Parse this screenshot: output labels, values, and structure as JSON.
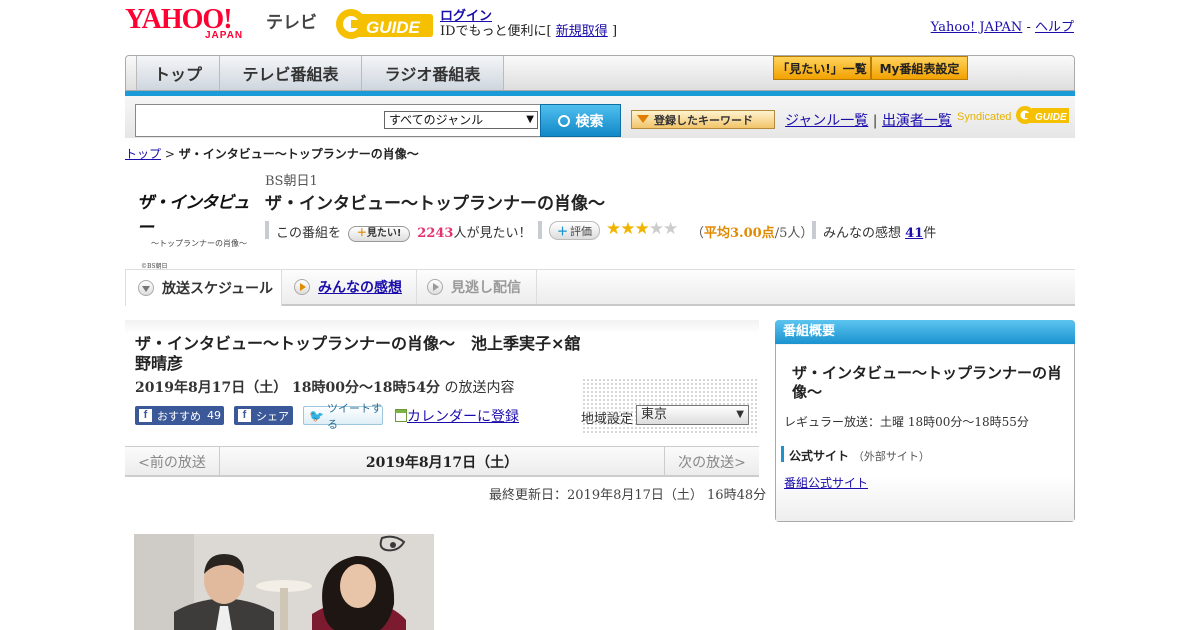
{
  "header": {
    "logo_text": "YAHOO!",
    "logo_sub": "JAPAN",
    "service_name": "テレビ",
    "gguide_text": "GUIDE",
    "login": "ログイン",
    "id_text": "IDでもっと便利に[",
    "signup": "新規取得",
    "id_close": "]",
    "yahoo_japan": "Yahoo! JAPAN",
    "sep": "-",
    "help": "ヘルプ"
  },
  "nav": {
    "tabs": [
      "トップ",
      "テレビ番組表",
      "ラジオ番組表"
    ],
    "want_list": "「見たい!」一覧",
    "my_schedule": "My番組表設定"
  },
  "search": {
    "genre_selected": "すべてのジャンル",
    "button": "検索",
    "keyword_button": "登録したキーワード",
    "genre_list": "ジャンル一覧",
    "divider": "|",
    "cast_list": "出演者一覧",
    "syndicated": "Syndicated"
  },
  "breadcrumb": {
    "top": "トップ",
    "sep": " > ",
    "current": "ザ・インタビュー～トップランナーの肖像～"
  },
  "program": {
    "logo_text": "ザ・インタビュー",
    "logo_sub": "～トップランナーの肖像～",
    "logo_copy": "©BS朝日",
    "channel": "BS朝日1",
    "title": "ザ・インタビュー～トップランナーの肖像～",
    "want_prefix": "この番組を",
    "want_button": "見たい!",
    "want_count": "2243",
    "want_suffix": "人が見たい！",
    "rating_button": "評価",
    "rating_value": 3,
    "rating_max": 5,
    "avg_open": "（",
    "avg_label": "平均3.00点",
    "avg_count": "/5人）",
    "review_label": "みんなの感想",
    "review_count": "41",
    "review_unit": "件"
  },
  "subtabs": {
    "schedule": "放送スケジュール",
    "reviews": "みんなの感想",
    "vod": "見逃し配信"
  },
  "episode": {
    "title": "ザ・インタビュー～トップランナーの肖像～　池上季実子×舘野晴彦",
    "date": "2019年8月17日（土）  18時00分～18時54分",
    "date_suffix": "の放送内容",
    "fb_recommend": "おすすめ",
    "fb_count": "49",
    "fb_share": "シェア",
    "tweet": "ツイートする",
    "calendar": "カレンダーに登録",
    "region_label": "地域設定",
    "region_value": "東京"
  },
  "pager": {
    "prev": "<前の放送",
    "date": "2019年8月17日（土）",
    "next": "次の放送>"
  },
  "updated": "最終更新日：2019年8月17日（土）  16時48分",
  "sidebar": {
    "heading": "番組概要",
    "title": "ザ・インタビュー～トップランナーの肖像～",
    "regular": "レギュラー放送：土曜 18時00分～18時55分",
    "official_head": "公式サイト",
    "official_note": "（外部サイト）",
    "official_link": "番組公式サイト"
  },
  "colors": {
    "accent_blue": "#1a9ad6",
    "yahoo_red": "#ff0033",
    "star": "#f0b400",
    "want_pink": "#e6336f"
  }
}
